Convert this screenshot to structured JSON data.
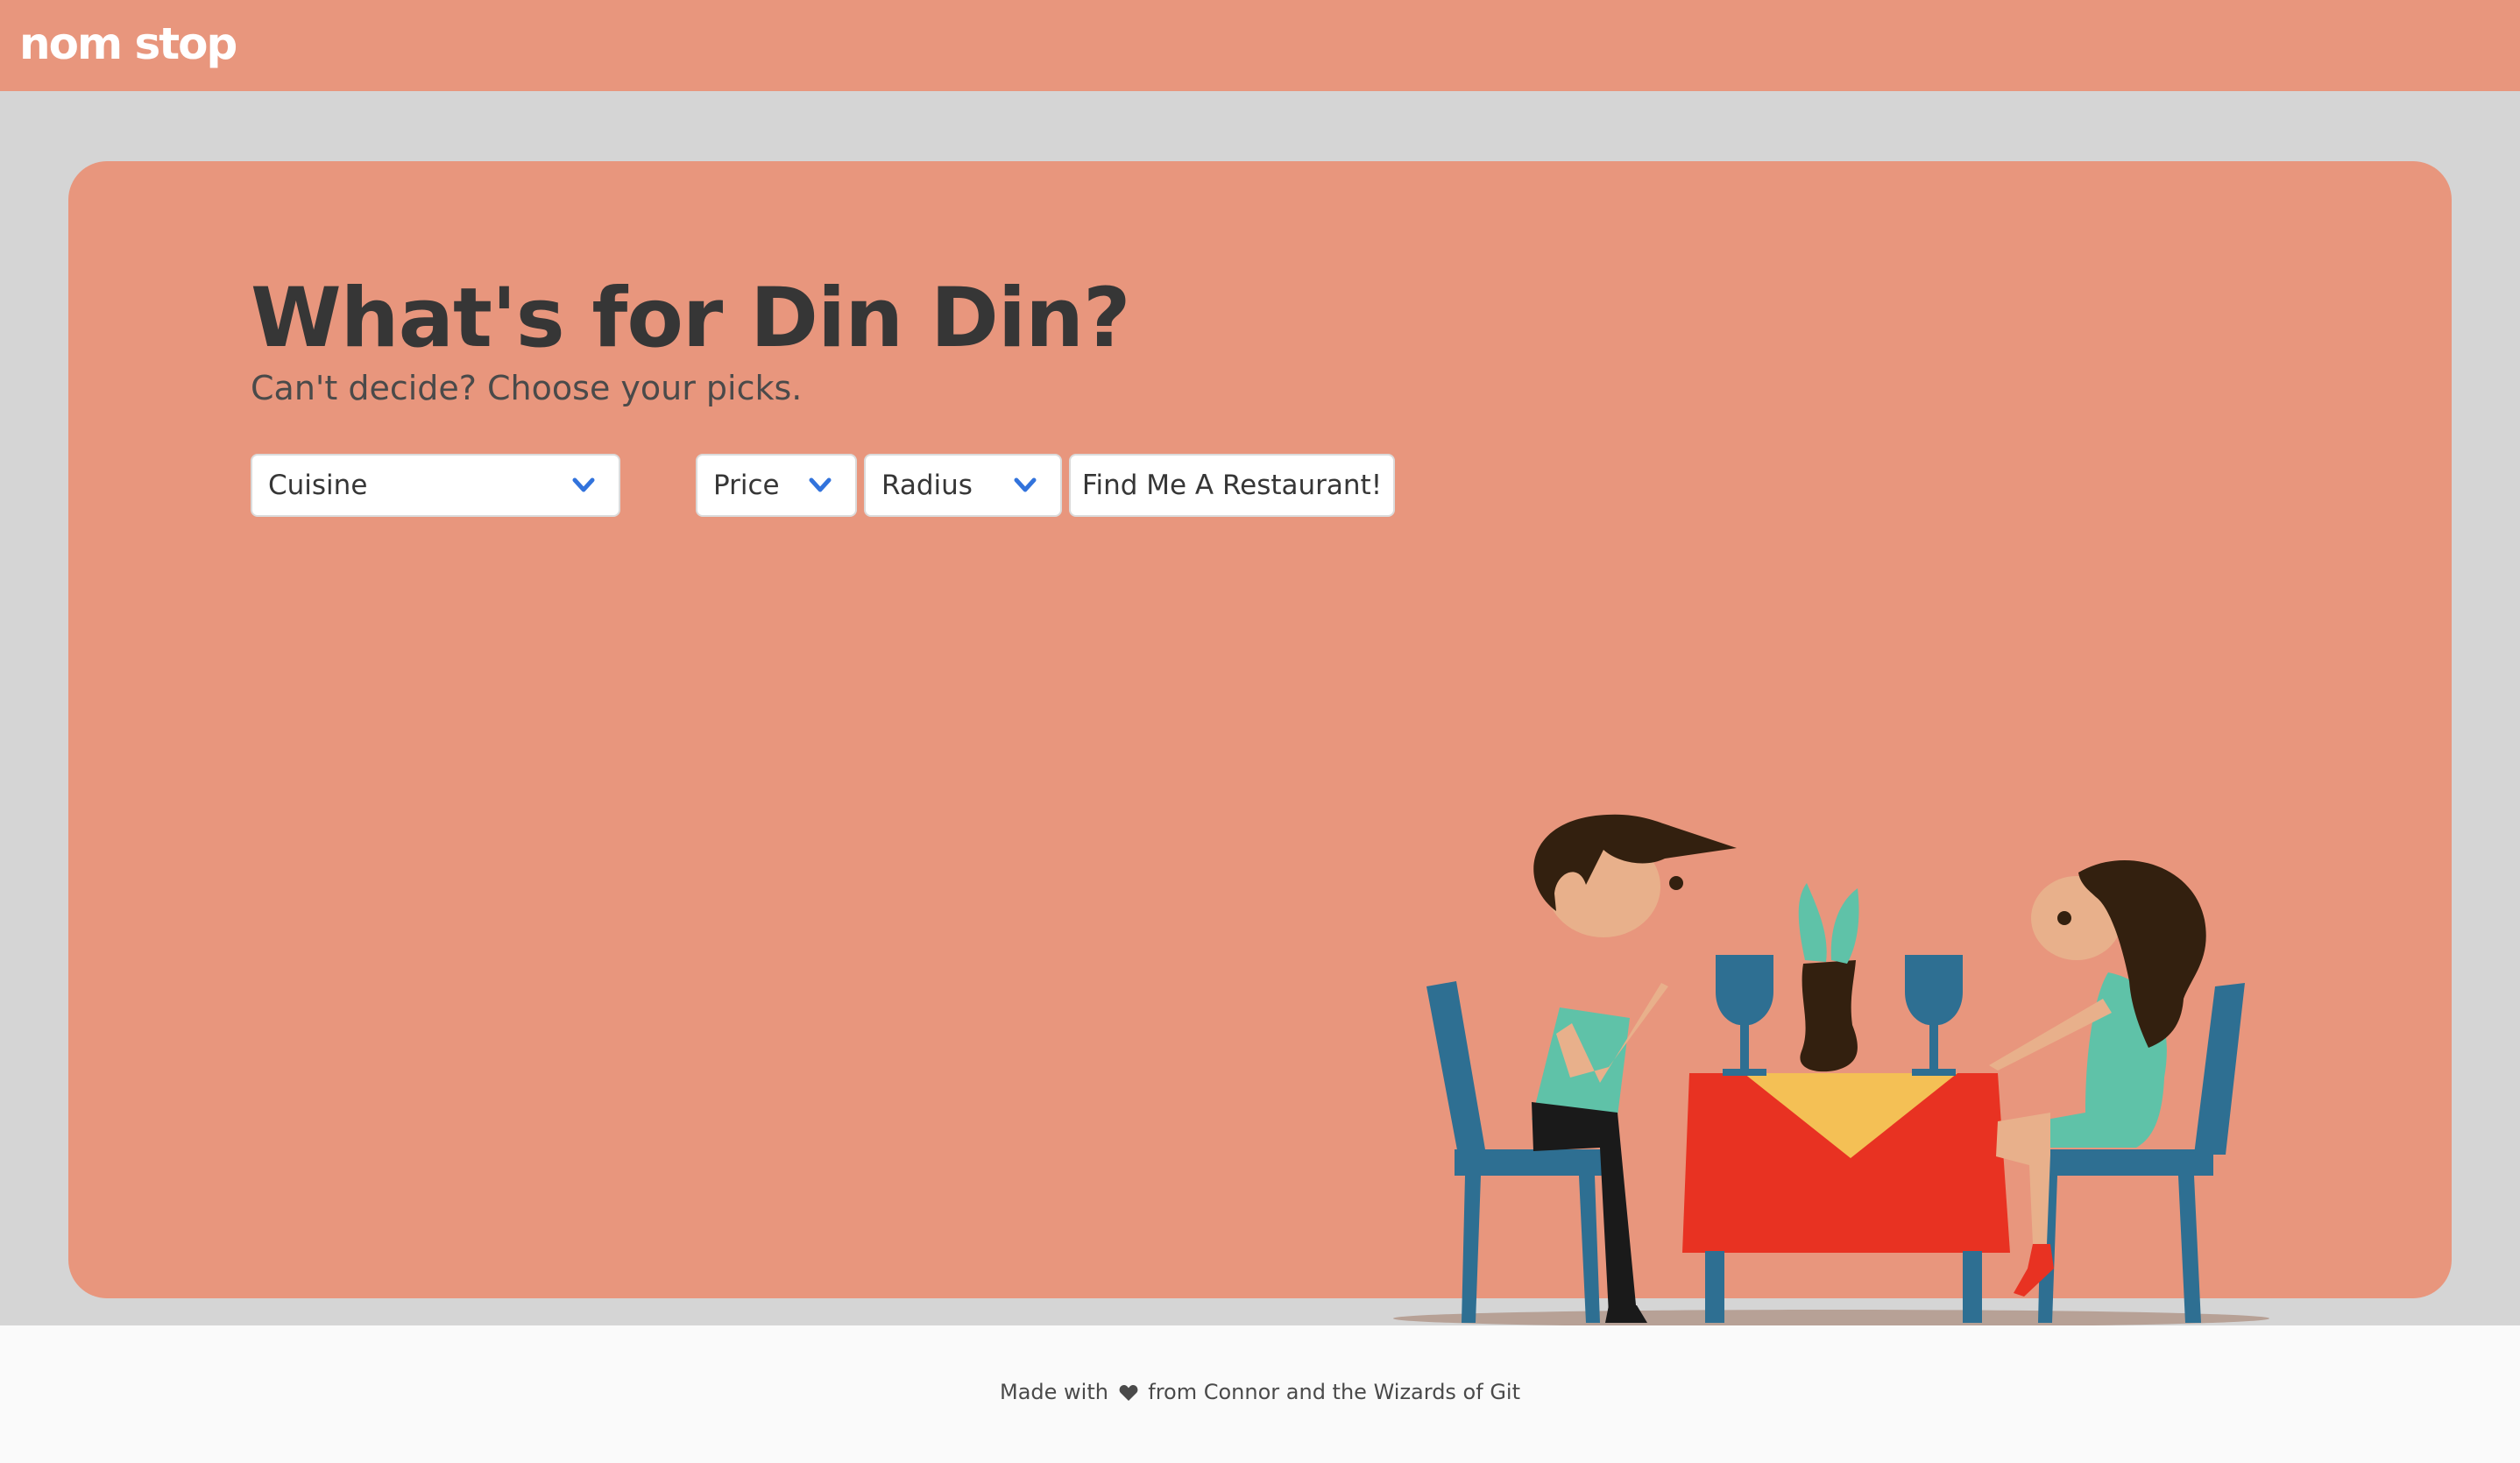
{
  "navbar": {
    "logo_text": "nom stop",
    "brand_color": "#e8967d"
  },
  "hero": {
    "title": "What's for Din Din?",
    "subtitle": "Can't decide? Choose your picks.",
    "filters": [
      {
        "label": "Cuisine",
        "icon": "chevron-down-icon"
      },
      {
        "label": "Price",
        "icon": "chevron-down-icon"
      },
      {
        "label": "Radius",
        "icon": "chevron-down-icon"
      }
    ],
    "submit_label": "Find Me A Restaurant!",
    "accent_color": "#3273dc"
  },
  "illustration": {
    "description_icon": "dinner-couple-illustration"
  },
  "footer": {
    "text_before": "Made with",
    "icon": "heart-icon",
    "text_after": "from Connor and the Wizards of Git"
  }
}
